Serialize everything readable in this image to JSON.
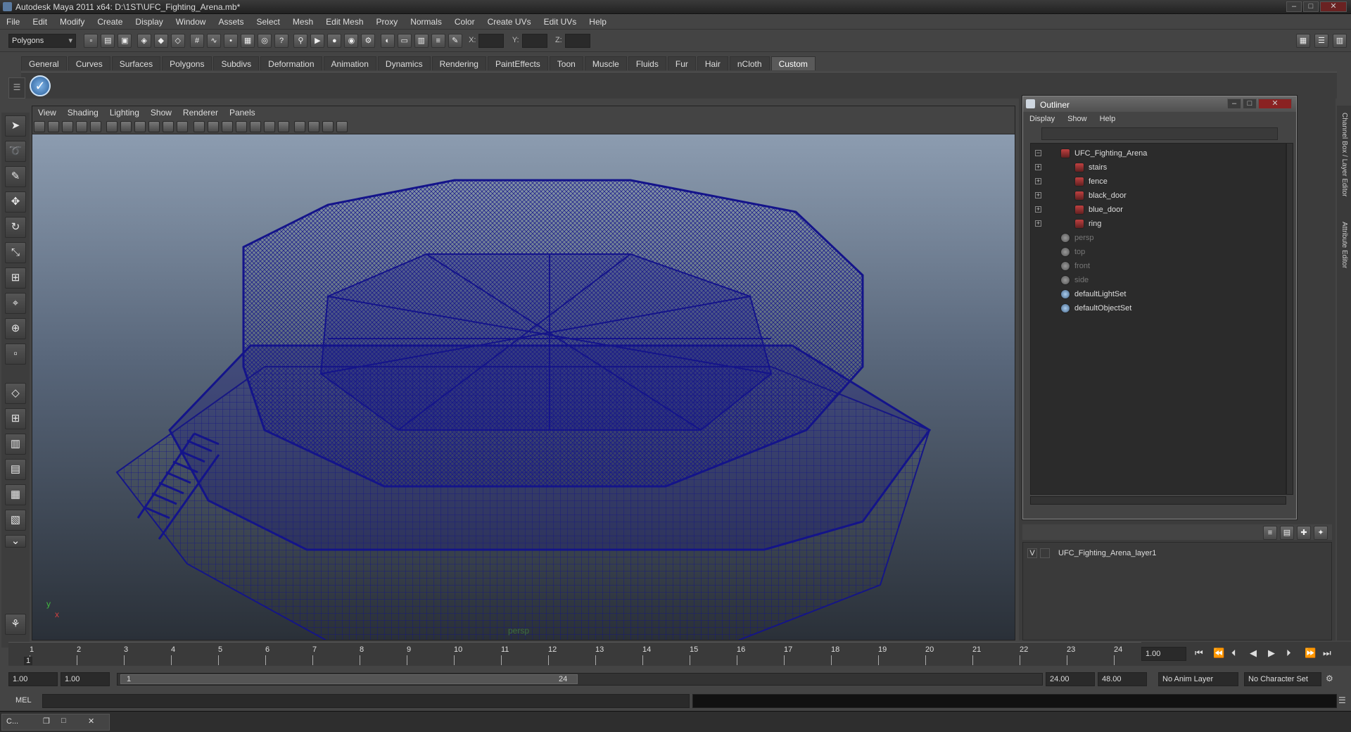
{
  "window": {
    "title": "Autodesk Maya 2011 x64: D:\\1ST\\UFC_Fighting_Arena.mb*",
    "minimize": "–",
    "maximize": "□",
    "close": "✕"
  },
  "menu": [
    "File",
    "Edit",
    "Modify",
    "Create",
    "Display",
    "Window",
    "Assets",
    "Select",
    "Mesh",
    "Edit Mesh",
    "Proxy",
    "Normals",
    "Color",
    "Create UVs",
    "Edit UVs",
    "Help"
  ],
  "status": {
    "mode": "Polygons",
    "x_label": "X:",
    "y_label": "Y:",
    "z_label": "Z:"
  },
  "shelf_tabs": [
    "General",
    "Curves",
    "Surfaces",
    "Polygons",
    "Subdivs",
    "Deformation",
    "Animation",
    "Dynamics",
    "Rendering",
    "PaintEffects",
    "Toon",
    "Muscle",
    "Fluids",
    "Fur",
    "Hair",
    "nCloth",
    "Custom"
  ],
  "shelf_active": "Custom",
  "viewport": {
    "menu": [
      "View",
      "Shading",
      "Lighting",
      "Show",
      "Renderer",
      "Panels"
    ],
    "camera_label": "persp",
    "axis_y": "y",
    "axis_x": "x"
  },
  "outliner": {
    "title": "Outliner",
    "menu": [
      "Display",
      "Show",
      "Help"
    ],
    "items": [
      {
        "name": "UFC_Fighting_Arena",
        "expand": "−",
        "type": "object",
        "indent": 0,
        "dim": false
      },
      {
        "name": "stairs",
        "expand": "+",
        "type": "object",
        "indent": 1,
        "dim": false
      },
      {
        "name": "fence",
        "expand": "+",
        "type": "object",
        "indent": 1,
        "dim": false
      },
      {
        "name": "black_door",
        "expand": "+",
        "type": "object",
        "indent": 1,
        "dim": false
      },
      {
        "name": "blue_door",
        "expand": "+",
        "type": "object",
        "indent": 1,
        "dim": false
      },
      {
        "name": "ring",
        "expand": "+",
        "type": "object",
        "indent": 1,
        "dim": false
      },
      {
        "name": "persp",
        "expand": "",
        "type": "camera",
        "indent": 0,
        "dim": true
      },
      {
        "name": "top",
        "expand": "",
        "type": "camera",
        "indent": 0,
        "dim": true
      },
      {
        "name": "front",
        "expand": "",
        "type": "camera",
        "indent": 0,
        "dim": true
      },
      {
        "name": "side",
        "expand": "",
        "type": "camera",
        "indent": 0,
        "dim": true
      },
      {
        "name": "defaultLightSet",
        "expand": "",
        "type": "set",
        "indent": 0,
        "dim": false
      },
      {
        "name": "defaultObjectSet",
        "expand": "",
        "type": "set",
        "indent": 0,
        "dim": false
      }
    ]
  },
  "channel_strip": [
    "Channel Box / Layer Editor",
    "Attribute Editor"
  ],
  "layers": [
    {
      "visible": "V",
      "name": "UFC_Fighting_Arena_layer1"
    }
  ],
  "timeline": {
    "ticks": [
      "1",
      "2",
      "3",
      "4",
      "5",
      "6",
      "7",
      "8",
      "9",
      "10",
      "11",
      "12",
      "13",
      "14",
      "15",
      "16",
      "17",
      "18",
      "19",
      "20",
      "21",
      "22",
      "23",
      "24"
    ],
    "current_marker": "1",
    "current_time": "1.00"
  },
  "range": {
    "start": "1.00",
    "playback_start": "1.00",
    "slider_start": "1",
    "slider_end": "24",
    "playback_end": "24.00",
    "end": "48.00",
    "anim_layer": "No Anim Layer",
    "character_set": "No Character Set"
  },
  "command": {
    "label": "MEL"
  },
  "taskbar": {
    "item": "C..."
  },
  "colors": {
    "wireframe": "#14148a",
    "accent": "#5a5a5a"
  }
}
